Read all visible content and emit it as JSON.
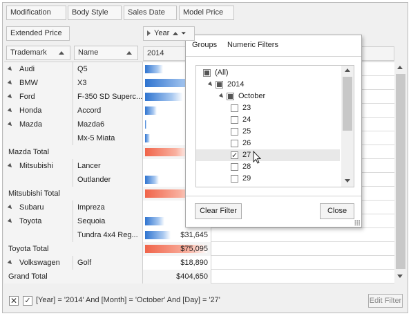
{
  "top_fields": [
    "Modification",
    "Body Style",
    "Sales Date",
    "Model Price"
  ],
  "data_fields": [
    "Extended Price"
  ],
  "column_fields": [
    "Year"
  ],
  "row_fields": [
    "Trademark",
    "Name"
  ],
  "column_header_value": "2014",
  "rows": [
    {
      "brand": "Audi",
      "name": "Q5",
      "value": "",
      "bar": 0.28,
      "type": "item"
    },
    {
      "brand": "BMW",
      "name": "X3",
      "value": "",
      "bar": 0.95,
      "type": "item"
    },
    {
      "brand": "Ford",
      "name": "F-350 SD Superc...",
      "value": "",
      "bar": 0.6,
      "type": "item"
    },
    {
      "brand": "Honda",
      "name": "Accord",
      "value": "",
      "bar": 0.18,
      "type": "item"
    },
    {
      "brand": "Mazda",
      "name": "Mazda6",
      "value": "",
      "bar": 0.02,
      "type": "item"
    },
    {
      "brand": "",
      "name": "Mx-5 Miata",
      "value": "",
      "bar": 0.08,
      "type": "item"
    },
    {
      "label": "Mazda Total",
      "value": "",
      "bar": 0.7,
      "type": "total"
    },
    {
      "brand": "Mitsubishi",
      "name": "Lancer",
      "value": "",
      "bar": 0.0,
      "type": "item"
    },
    {
      "brand": "",
      "name": "Outlander",
      "value": "",
      "bar": 0.22,
      "type": "item"
    },
    {
      "label": "Mitsubishi Total",
      "value": "",
      "bar": 0.8,
      "type": "total"
    },
    {
      "brand": "Subaru",
      "name": "Impreza",
      "value": "",
      "bar": 0.0,
      "type": "item"
    },
    {
      "brand": "Toyota",
      "name": "Sequoia",
      "value": "",
      "bar": 0.3,
      "type": "item"
    },
    {
      "brand": "",
      "name": "Tundra 4x4 Reg...",
      "value": "$31,645",
      "bar": 0.4,
      "type": "item"
    },
    {
      "label": "Toyota Total",
      "value": "$75,095",
      "bar": 0.98,
      "type": "total"
    },
    {
      "brand": "Volkswagen",
      "name": "Golf",
      "value": "$18,890",
      "bar": 0.0,
      "type": "item"
    },
    {
      "label": "Grand Total",
      "value": "$404,650",
      "bar": 0.0,
      "type": "grandtotal"
    }
  ],
  "clipped_values": [
    "$",
    "$",
    "$",
    "$",
    "$",
    "$",
    "$6",
    "$",
    "$",
    "$",
    "$",
    "$"
  ],
  "filter_popup": {
    "tabs": [
      "Groups",
      "Numeric Filters"
    ],
    "tree": [
      {
        "label": "(All)",
        "level": 0,
        "state": "indet",
        "expand": ""
      },
      {
        "label": "2014",
        "level": 1,
        "state": "indet",
        "expand": "down"
      },
      {
        "label": "October",
        "level": 2,
        "state": "indet",
        "expand": "down"
      },
      {
        "label": "23",
        "level": 3,
        "state": "unchecked",
        "expand": ""
      },
      {
        "label": "24",
        "level": 3,
        "state": "unchecked",
        "expand": ""
      },
      {
        "label": "25",
        "level": 3,
        "state": "unchecked",
        "expand": ""
      },
      {
        "label": "26",
        "level": 3,
        "state": "unchecked",
        "expand": ""
      },
      {
        "label": "27",
        "level": 3,
        "state": "checked",
        "expand": ""
      },
      {
        "label": "28",
        "level": 3,
        "state": "unchecked",
        "expand": ""
      },
      {
        "label": "29",
        "level": 3,
        "state": "unchecked",
        "expand": ""
      }
    ],
    "clear_label": "Clear Filter",
    "close_label": "Close"
  },
  "footer": {
    "filter_text": "[Year] = '2014' And [Month] = 'October' And [Day] = '27'",
    "edit_label": "Edit Filter"
  },
  "colors": {
    "bar_blue": "#2f74d0",
    "bar_red": "#f0644a"
  }
}
